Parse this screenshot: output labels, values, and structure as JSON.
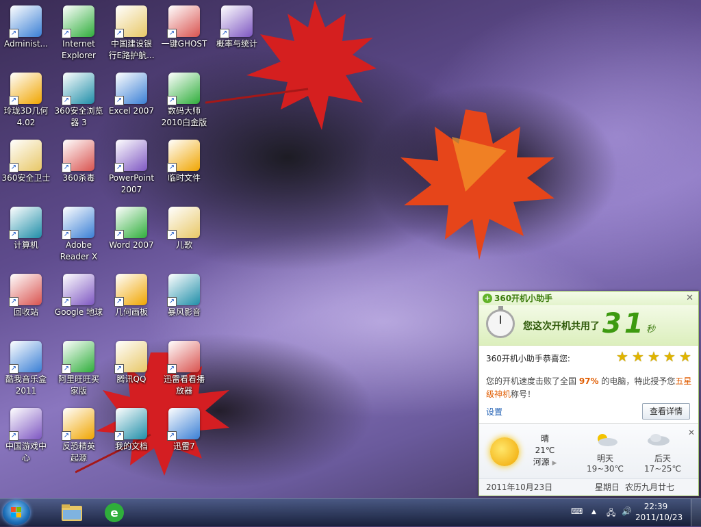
{
  "desktop_icons": [
    {
      "label": "Administ...",
      "x": 0,
      "y": 0
    },
    {
      "label": "Internet\nExplorer",
      "x": 1,
      "y": 0
    },
    {
      "label": "中国建设银\n行E路护航...",
      "x": 2,
      "y": 0
    },
    {
      "label": "一键GHOST",
      "x": 3,
      "y": 0
    },
    {
      "label": "概率与统计",
      "x": 4,
      "y": 0
    },
    {
      "label": "玲珑3D几何\n4.02",
      "x": 0,
      "y": 1
    },
    {
      "label": "360安全浏览\n器 3",
      "x": 1,
      "y": 1
    },
    {
      "label": "Excel 2007",
      "x": 2,
      "y": 1
    },
    {
      "label": "数码大师\n2010白金版",
      "x": 3,
      "y": 1
    },
    {
      "label": "360安全卫士",
      "x": 0,
      "y": 2
    },
    {
      "label": "360杀毒",
      "x": 1,
      "y": 2
    },
    {
      "label": "PowerPoint\n2007",
      "x": 2,
      "y": 2
    },
    {
      "label": "临时文件",
      "x": 3,
      "y": 2
    },
    {
      "label": "计算机",
      "x": 0,
      "y": 3
    },
    {
      "label": "Adobe\nReader X",
      "x": 1,
      "y": 3
    },
    {
      "label": "Word 2007",
      "x": 2,
      "y": 3
    },
    {
      "label": "儿歌",
      "x": 3,
      "y": 3
    },
    {
      "label": "回收站",
      "x": 0,
      "y": 4
    },
    {
      "label": "Google 地球",
      "x": 1,
      "y": 4
    },
    {
      "label": "几何画板",
      "x": 2,
      "y": 4
    },
    {
      "label": "暴风影音",
      "x": 3,
      "y": 4
    },
    {
      "label": "酷我音乐盒\n2011",
      "x": 0,
      "y": 5
    },
    {
      "label": "阿里旺旺买\n家版",
      "x": 1,
      "y": 5
    },
    {
      "label": "腾讯QQ",
      "x": 2,
      "y": 5
    },
    {
      "label": "迅雷看看播\n放器",
      "x": 3,
      "y": 5
    },
    {
      "label": "中国游戏中\n心",
      "x": 0,
      "y": 6
    },
    {
      "label": "反恐精英\n起源",
      "x": 1,
      "y": 6
    },
    {
      "label": "我的文档",
      "x": 2,
      "y": 6
    },
    {
      "label": "迅雷7",
      "x": 3,
      "y": 6
    }
  ],
  "popup": {
    "title": "360开机小助手",
    "timer_text": "您这次开机共用了",
    "seconds": "31",
    "unit": "秒",
    "congrats": "360开机小助手恭喜您:",
    "stars": [
      "★",
      "★",
      "★",
      "★",
      "★"
    ],
    "desc_1": "您的开机速度击败了全国 ",
    "percent": "97%",
    "desc_2": " 的电脑，特此授予您",
    "title_award": "五星级神机",
    "desc_3": "称号！",
    "settings_link": "设置",
    "detail_button": "查看详情",
    "weather": {
      "today_cond": "晴",
      "today_temp": "21℃",
      "city": "河源",
      "tomorrow": "明天",
      "tomorrow_temp": "19~30℃",
      "after": "后天",
      "after_temp": "17~25℃"
    },
    "footer_date": "2011年10月23日",
    "footer_week": "星期日",
    "footer_lunar": "农历九月廿七"
  },
  "taskbar": {
    "time": "22:39",
    "date": "2011/10/23",
    "pinned": [
      "folder-icon",
      "360-browser-icon"
    ]
  },
  "colors": {
    "accent": "#3d9a10",
    "link": "#1f5fb3",
    "highlight": "#e05c00"
  }
}
